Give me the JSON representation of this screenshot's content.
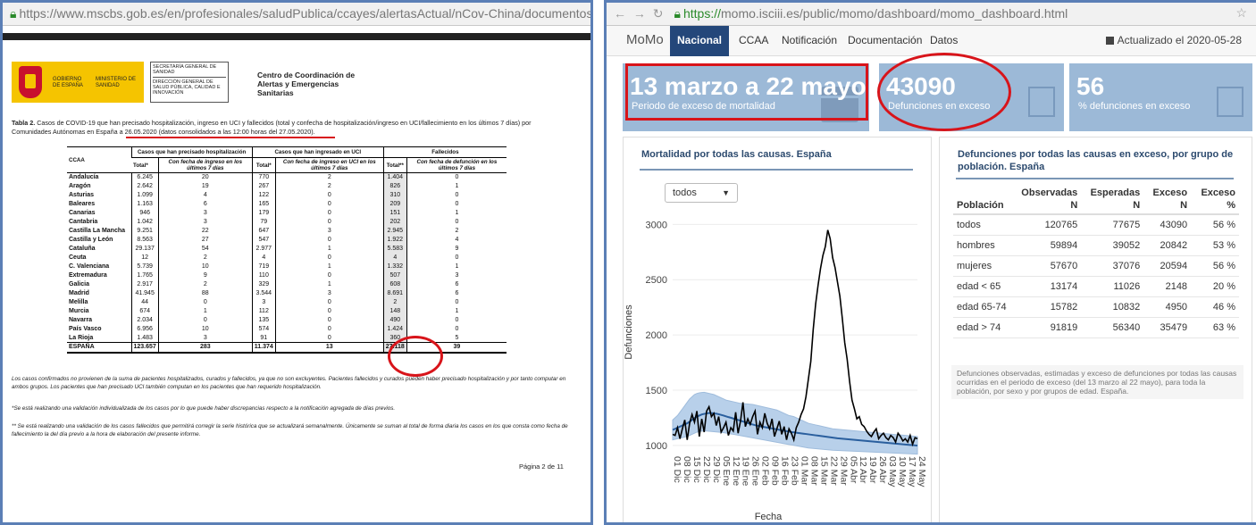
{
  "left": {
    "url": "https://www.mscbs.gob.es/en/profesionales/saludPublica/ccayes/alertasActual/nCov-China/documentos/Actualizaci",
    "logo": {
      "gobierno": "GOBIERNO DE ESPAÑA",
      "ministerio": "MINISTERIO DE SANIDAD"
    },
    "sec": {
      "line1": "SECRETARÍA GENERAL DE SANIDAD",
      "line2": "DIRECCIÓN GENERAL DE SALUD PÚBLICA, CALIDAD E INNOVACIÓN"
    },
    "ccaes": "Centro de Coordinación de Alertas y Emergencias Sanitarias",
    "caption_bold": "Tabla 2.",
    "caption": " Casos de COVID-19 que han precisado hospitalización, ingreso en UCI y fallecidos (total y confecha de hospitalización/ingreso en UCI/fallecimiento en los últimos 7 días) por Comunidades Autónomas en España a 26.05.2020 (datos consolidados a las 12:00 horas del 27.05.2020).",
    "table": {
      "h_ccaa": "CCAA",
      "h_hosp": "Casos que han precisado hospitalización",
      "h_uci": "Casos que han ingresado en UCI",
      "h_fall": "Fallecidos",
      "h_total": "Total*",
      "h_total2": "Total**",
      "h_7h": "Con fecha de ingreso en los últimos 7 días",
      "h_7u": "Con fecha de ingreso en UCI en los últimos 7 días",
      "h_7f": "Con fecha de defunción en los últimos 7 días",
      "rows": [
        [
          "Andalucía",
          "6.245",
          "20",
          "770",
          "2",
          "1.404",
          "0"
        ],
        [
          "Aragón",
          "2.642",
          "19",
          "267",
          "2",
          "826",
          "1"
        ],
        [
          "Asturias",
          "1.099",
          "4",
          "122",
          "0",
          "310",
          "0"
        ],
        [
          "Baleares",
          "1.163",
          "6",
          "165",
          "0",
          "209",
          "0"
        ],
        [
          "Canarias",
          "946",
          "3",
          "179",
          "0",
          "151",
          "1"
        ],
        [
          "Cantabria",
          "1.042",
          "3",
          "79",
          "0",
          "202",
          "0"
        ],
        [
          "Castilla La Mancha",
          "9.251",
          "22",
          "647",
          "3",
          "2.945",
          "2"
        ],
        [
          "Castilla y León",
          "8.563",
          "27",
          "547",
          "0",
          "1.922",
          "4"
        ],
        [
          "Cataluña",
          "29.137",
          "54",
          "2.977",
          "1",
          "5.583",
          "9"
        ],
        [
          "Ceuta",
          "12",
          "2",
          "4",
          "0",
          "4",
          "0"
        ],
        [
          "C. Valenciana",
          "5.739",
          "10",
          "719",
          "1",
          "1.332",
          "1"
        ],
        [
          "Extremadura",
          "1.765",
          "9",
          "110",
          "0",
          "507",
          "3"
        ],
        [
          "Galicia",
          "2.917",
          "2",
          "329",
          "1",
          "608",
          "6"
        ],
        [
          "Madrid",
          "41.945",
          "88",
          "3.544",
          "3",
          "8.691",
          "6"
        ],
        [
          "Melilla",
          "44",
          "0",
          "3",
          "0",
          "2",
          "0"
        ],
        [
          "Murcia",
          "674",
          "1",
          "112",
          "0",
          "148",
          "1"
        ],
        [
          "Navarra",
          "2.034",
          "0",
          "135",
          "0",
          "490",
          "0"
        ],
        [
          "País Vasco",
          "6.956",
          "10",
          "574",
          "0",
          "1.424",
          "0"
        ],
        [
          "La Rioja",
          "1.483",
          "3",
          "91",
          "0",
          "360",
          "5"
        ]
      ],
      "total": [
        "ESPAÑA",
        "123.657",
        "283",
        "11.374",
        "13",
        "27.118",
        "39"
      ]
    },
    "note1": "Los casos confirmados no provienen de la suma de pacientes hospitalizados, curados y fallecidos, ya que no son excluyentes. Pacientes fallecidos y curados pueden haber precisado hospitalización y por tanto computar en ambos grupos. Los pacientes que han precisado UCI también computan en los pacientes que han requerido hospitalización.",
    "note2": "*Se está realizando una validación individualizada de los casos por lo que puede haber discrepancias respecto a la notificación agregada de días previos.",
    "note3": "** Se está realizando una validación de los casos fallecidos que permitirá corregir la serie histórica que se actualizará semanalmente. Únicamente se suman al total de forma diaria los casos en los que consta como fecha de fallecimiento la del día previo a la hora de elaboración del presente informe.",
    "page": "Página 2 de 11"
  },
  "right": {
    "url_https": "https://",
    "url_rest": "momo.isciii.es/public/momo/dashboard/momo_dashboard.html",
    "nav": {
      "brand": "MoMo",
      "items": [
        "Nacional",
        "CCAA",
        "Notificación",
        "Documentación",
        "Datos"
      ],
      "updated": "Actualizado el 2020-05-28"
    },
    "boxes": [
      {
        "value": "13 marzo a 22 mayo",
        "label": "Periodo de exceso de mortalidad"
      },
      {
        "value": "43090",
        "label": "Defunciones en exceso"
      },
      {
        "value": "56",
        "label": "% defunciones en exceso"
      }
    ],
    "chart_title": "Mortalidad por todas las causas. España",
    "select": "todos",
    "side_title": "Defunciones por todas las causas en exceso, por grupo de población. España",
    "stable": {
      "headers": [
        "Población",
        "Observadas N",
        "Esperadas N",
        "Exceso N",
        "Exceso %"
      ],
      "rows": [
        [
          "todos",
          "120765",
          "77675",
          "43090",
          "56 %"
        ],
        [
          "hombres",
          "59894",
          "39052",
          "20842",
          "53 %"
        ],
        [
          "mujeres",
          "57670",
          "37076",
          "20594",
          "56 %"
        ],
        [
          "edad < 65",
          "13174",
          "11026",
          "2148",
          "20 %"
        ],
        [
          "edad 65-74",
          "15782",
          "10832",
          "4950",
          "46 %"
        ],
        [
          "edad > 74",
          "91819",
          "56340",
          "35479",
          "63 %"
        ]
      ]
    },
    "footnote": "Defunciones observadas, estimadas y exceso de defunciones por todas las causas ocurridas en el periodo de exceso (del 13 marzo al 22 mayo), para toda la población, por sexo y por grupos de edad. España."
  },
  "chart_data": {
    "type": "line",
    "title": "Mortalidad por todas las causas. España",
    "xlabel": "Fecha",
    "ylabel": "Defunciones",
    "ylim": [
      950,
      3100
    ],
    "yticks": [
      1000,
      1500,
      2000,
      2500,
      3000
    ],
    "x_ticks": [
      "01 Dic",
      "08 Dic",
      "15 Dic",
      "22 Dic",
      "29 Dic",
      "05 Ene",
      "12 Ene",
      "19 Ene",
      "26 Ene",
      "02 Feb",
      "09 Feb",
      "16 Feb",
      "23 Feb",
      "01 Mar",
      "08 Mar",
      "15 Mar",
      "22 Mar",
      "29 Mar",
      "05 Abr",
      "12 Abr",
      "19 Abr",
      "26 Abr",
      "03 May",
      "10 May",
      "17 May",
      "24 May"
    ],
    "series": [
      {
        "values": [
          1100,
          1090,
          1160,
          1060,
          1150,
          1230,
          1050,
          1200,
          1280,
          1210,
          1310,
          1080,
          1240,
          1120,
          1310,
          1350,
          1260,
          1290,
          1180,
          1260,
          1120,
          1160,
          1210,
          1090,
          1160,
          1130,
          1300,
          1110,
          1220,
          1390,
          1170,
          1240,
          1190,
          1260,
          1310,
          1100,
          1210,
          1160,
          1290,
          1200,
          1150,
          1240,
          1080,
          1150,
          1220,
          1100,
          1170,
          1050,
          1150,
          1110,
          1050,
          1160,
          1210,
          1280,
          1330,
          1440,
          1600,
          1760,
          2050,
          2280,
          2450,
          2600,
          2720,
          2800,
          2950,
          2870,
          2700,
          2610,
          2480,
          2350,
          2150,
          1930,
          1780,
          1580,
          1410,
          1330,
          1240,
          1260,
          1190,
          1170,
          1130,
          1100,
          1080,
          1120,
          1150,
          1060,
          1090,
          1110,
          1070,
          1050,
          1090,
          1070,
          1030,
          1110,
          1080,
          1040,
          1060,
          1030,
          1090,
          1010,
          1070,
          1060
        ]
      },
      {
        "values": [
          1140,
          1150,
          1160,
          1170,
          1180,
          1190,
          1200,
          1215,
          1230,
          1245,
          1260,
          1270,
          1280,
          1285,
          1290,
          1292,
          1292,
          1290,
          1287,
          1282,
          1276,
          1270,
          1263,
          1256,
          1250,
          1243,
          1236,
          1230,
          1223,
          1216,
          1209,
          1202,
          1195,
          1189,
          1183,
          1178,
          1173,
          1169,
          1165,
          1161,
          1157,
          1153,
          1149,
          1145,
          1141,
          1137,
          1133,
          1129,
          1125,
          1121,
          1118,
          1115,
          1112,
          1109,
          1106,
          1103,
          1100,
          1097,
          1094,
          1091,
          1088,
          1085,
          1082,
          1079,
          1076,
          1073,
          1070,
          1067,
          1064,
          1062,
          1060,
          1058,
          1056,
          1054,
          1052,
          1050,
          1048,
          1046,
          1044,
          1042,
          1040,
          1038,
          1036,
          1034,
          1032,
          1030,
          1028,
          1026,
          1024,
          1022,
          1020,
          1018,
          1016,
          1014,
          1012,
          1010,
          1008,
          1006,
          1004,
          1002,
          1000,
          998
        ]
      },
      {
        "values": [
          1230,
          1250,
          1270,
          1300,
          1330,
          1360,
          1390,
          1420,
          1440,
          1460,
          1470,
          1475,
          1478,
          1480,
          1475,
          1470,
          1465,
          1460,
          1450,
          1440,
          1430,
          1420,
          1410,
          1405,
          1400,
          1395,
          1390,
          1385,
          1380,
          1378,
          1376,
          1374,
          1372,
          1370,
          1365,
          1360,
          1355,
          1350,
          1345,
          1340,
          1335,
          1330,
          1325,
          1320,
          1310,
          1300,
          1290,
          1280,
          1270,
          1265,
          1260,
          1250,
          1240,
          1230,
          1220,
          1210,
          1200,
          1195,
          1190,
          1185,
          1180,
          1175,
          1170,
          1165,
          1160,
          1155,
          1150,
          1148,
          1146,
          1144,
          1142,
          1140,
          1138,
          1136,
          1134,
          1132,
          1130,
          1128,
          1126,
          1124,
          1122,
          1120,
          1118,
          1116,
          1114,
          1112,
          1110,
          1108,
          1106,
          1104,
          1102,
          1100,
          1098,
          1096,
          1094,
          1092,
          1090,
          1088,
          1086,
          1084,
          1082,
          1080
        ]
      },
      {
        "values": [
          1050,
          1055,
          1060,
          1065,
          1070,
          1075,
          1080,
          1090,
          1100,
          1110,
          1120,
          1125,
          1130,
          1130,
          1130,
          1128,
          1126,
          1124,
          1122,
          1120,
          1118,
          1115,
          1112,
          1108,
          1104,
          1100,
          1096,
          1092,
          1088,
          1084,
          1080,
          1076,
          1072,
          1068,
          1064,
          1060,
          1056,
          1052,
          1048,
          1044,
          1040,
          1036,
          1032,
          1028,
          1024,
          1020,
          1016,
          1012,
          1008,
          1004,
          1000,
          996,
          992,
          988,
          984,
          980,
          976,
          974,
          972,
          970,
          968,
          966,
          964,
          962,
          960,
          958,
          956,
          955,
          954,
          953,
          952,
          951,
          950,
          949,
          948,
          947,
          946,
          945,
          944,
          943,
          942,
          941,
          940,
          939,
          938,
          937,
          936,
          935,
          934,
          933,
          932,
          931,
          930,
          929,
          928,
          927,
          926,
          925,
          924,
          923,
          922,
          921
        ]
      }
    ]
  }
}
